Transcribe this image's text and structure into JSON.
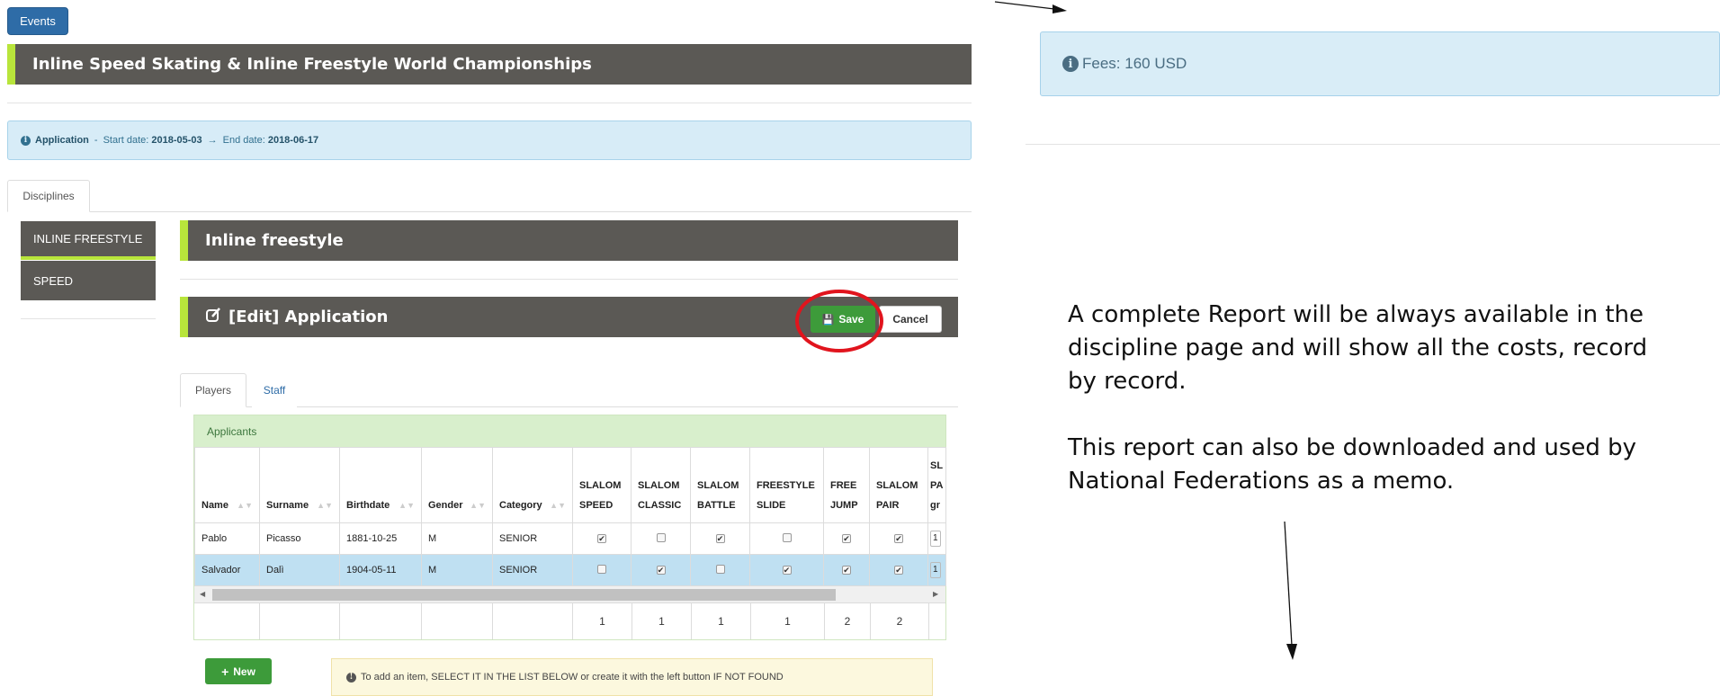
{
  "events_button": "Events",
  "event_title": "Inline Speed Skating & Inline Freestyle World Championships",
  "application_info": {
    "label": "Application",
    "sep": "-",
    "start_label": "Start date:",
    "start_date": "2018-05-03",
    "arrow": "→",
    "end_label": "End date:",
    "end_date": "2018-06-17"
  },
  "tabs": {
    "disciplines": "Disciplines"
  },
  "sidebar": {
    "items": [
      {
        "label": "INLINE FREESTYLE"
      },
      {
        "label": "SPEED"
      }
    ]
  },
  "discipline_title": "Inline freestyle",
  "edit_header": {
    "title": "[Edit] Application",
    "save": "Save",
    "cancel": "Cancel"
  },
  "subtabs": {
    "players": "Players",
    "staff": "Staff"
  },
  "applicants": {
    "title": "Applicants",
    "columns": [
      "Name",
      "Surname",
      "Birthdate",
      "Gender",
      "Category",
      "SLALOM SPEED",
      "SLALOM CLASSIC",
      "SLALOM BATTLE",
      "FREESTYLE SLIDE",
      "FREE JUMP",
      "SLALOM PAIR",
      "SL PA gr"
    ],
    "rows": [
      {
        "name": "Pablo",
        "surname": "Picasso",
        "birthdate": "1881-10-25",
        "gender": "M",
        "category": "SENIOR",
        "checks": [
          true,
          false,
          true,
          false,
          true,
          true
        ],
        "extra": "1"
      },
      {
        "name": "Salvador",
        "surname": "Dalì",
        "birthdate": "1904-05-11",
        "gender": "M",
        "category": "SENIOR",
        "checks": [
          false,
          true,
          false,
          true,
          true,
          true
        ],
        "extra": "1"
      }
    ],
    "totals": [
      "1",
      "1",
      "1",
      "1",
      "2",
      "2"
    ]
  },
  "new_button": "New",
  "hint": "To add an item, SELECT IT IN THE LIST BELOW or create it with the left button IF NOT FOUND",
  "fees": "Fees: 160 USD",
  "note": {
    "line1": "A complete Report will be always available in the",
    "line2": "discipline page and will show all the costs, record",
    "line3": "by record.",
    "line4": "This report can also be downloaded and used by",
    "line5": "National Federations as a memo."
  },
  "colors": {
    "accent": "#b8e53b",
    "bar": "#5b5955",
    "save": "#3d9b3a",
    "highlight": "#e1141d"
  }
}
